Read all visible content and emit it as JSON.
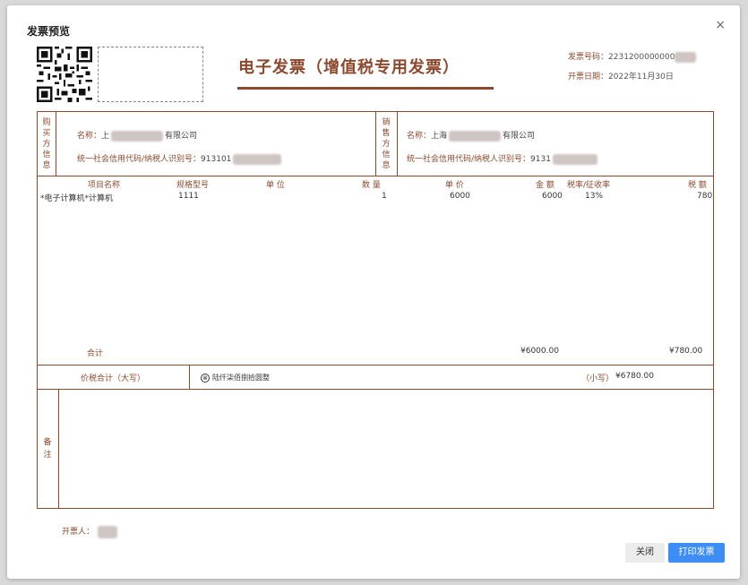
{
  "dialog": {
    "title": "发票预览",
    "close_icon": "×"
  },
  "invoice": {
    "title": "电子发票（增值税专用发票）",
    "number_label": "发票号码：",
    "number_value": "2231200000000",
    "date_label": "开票日期：",
    "date_value": "2022年11月30日",
    "buyer": {
      "section_label": [
        "购",
        "买",
        "方",
        "信",
        "息"
      ],
      "name_label": "名称：",
      "name_prefix": "上",
      "name_suffix": "有限公司",
      "tax_id_label": "统一社会信用代码/纳税人识别号：",
      "tax_id_prefix": "913101"
    },
    "seller": {
      "section_label": [
        "销",
        "售",
        "方",
        "信",
        "息"
      ],
      "name_label": "名称：",
      "name_prefix": "上海",
      "name_suffix": "有限公司",
      "tax_id_label": "统一社会信用代码/纳税人识别号：",
      "tax_id_prefix": "9131"
    },
    "columns": {
      "item": "项目名称",
      "spec": "规格型号",
      "unit": "单 位",
      "qty": "数 量",
      "price": "单 价",
      "amount": "金 额",
      "rate": "税率/征收率",
      "tax": "税 额"
    },
    "items": [
      {
        "item": "*电子计算机*计算机",
        "spec": "1111",
        "unit": "",
        "qty": "1",
        "price": "6000",
        "amount": "6000",
        "rate": "13%",
        "tax": "780"
      }
    ],
    "total_label": "合计",
    "total_amount": "¥6000.00",
    "total_tax": "¥780.00",
    "grand_total_label": "价税合计（大写）",
    "grand_total_caps_icon": "⊗",
    "grand_total_caps": "陆仟柒佰捌拾圆整",
    "grand_total_small_label": "（小写）",
    "grand_total_small": "¥6780.00",
    "remarks_label": [
      "备",
      "注"
    ],
    "issuer_label": "开票人："
  },
  "buttons": {
    "close": "关闭",
    "print": "打印发票"
  },
  "colors": {
    "accent": "#8b4a30",
    "primary_button": "#3d8df5"
  }
}
